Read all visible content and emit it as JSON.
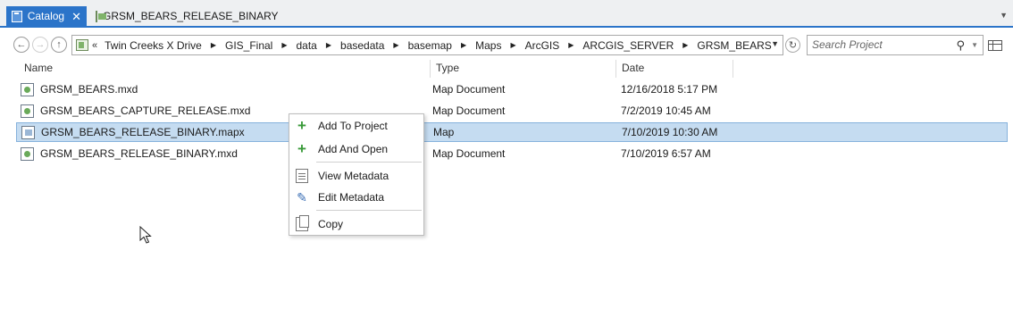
{
  "tabs": [
    {
      "label": "Catalog",
      "close": "✕",
      "active": true
    },
    {
      "label": "GRSM_BEARS_RELEASE_BINARY",
      "active": false
    }
  ],
  "address": {
    "overflow": "«",
    "crumbs": [
      "Twin Creeks X Drive",
      "GIS_Final",
      "data",
      "basedata",
      "basemap",
      "Maps",
      "ArcGIS",
      "ARCGIS_SERVER",
      "GRSM_BEARS"
    ]
  },
  "search": {
    "placeholder": "Search Project"
  },
  "columns": {
    "name": "Name",
    "type": "Type",
    "date": "Date"
  },
  "rows": [
    {
      "name": "GRSM_BEARS.mxd",
      "type": "Map Document",
      "date": "12/16/2018 5:17 PM",
      "icon": "mxd-file-icon",
      "selected": false
    },
    {
      "name": "GRSM_BEARS_CAPTURE_RELEASE.mxd",
      "type": "Map Document",
      "date": "7/2/2019 10:45 AM",
      "icon": "mxd-file-icon",
      "selected": false
    },
    {
      "name": "GRSM_BEARS_RELEASE_BINARY.mapx",
      "type": "Map",
      "date": "7/10/2019 10:30 AM",
      "icon": "mapx-file-icon",
      "selected": true
    },
    {
      "name": "GRSM_BEARS_RELEASE_BINARY.mxd",
      "type": "Map Document",
      "date": "7/10/2019 6:57 AM",
      "icon": "mxd-file-icon",
      "selected": false
    }
  ],
  "context_menu": {
    "items": [
      {
        "label": "Add To Project",
        "icon": "plus-icon"
      },
      {
        "label": "Add And Open",
        "icon": "plus-icon"
      },
      {
        "label": "View Metadata",
        "icon": "metadata-icon"
      },
      {
        "label": "Edit Metadata",
        "icon": "pencil-icon"
      },
      {
        "label": "Copy",
        "icon": "copy-icon"
      }
    ]
  },
  "colors": {
    "accent": "#2b74c9",
    "selection": "#c5dcf1",
    "add_green": "#3a9a3a"
  }
}
